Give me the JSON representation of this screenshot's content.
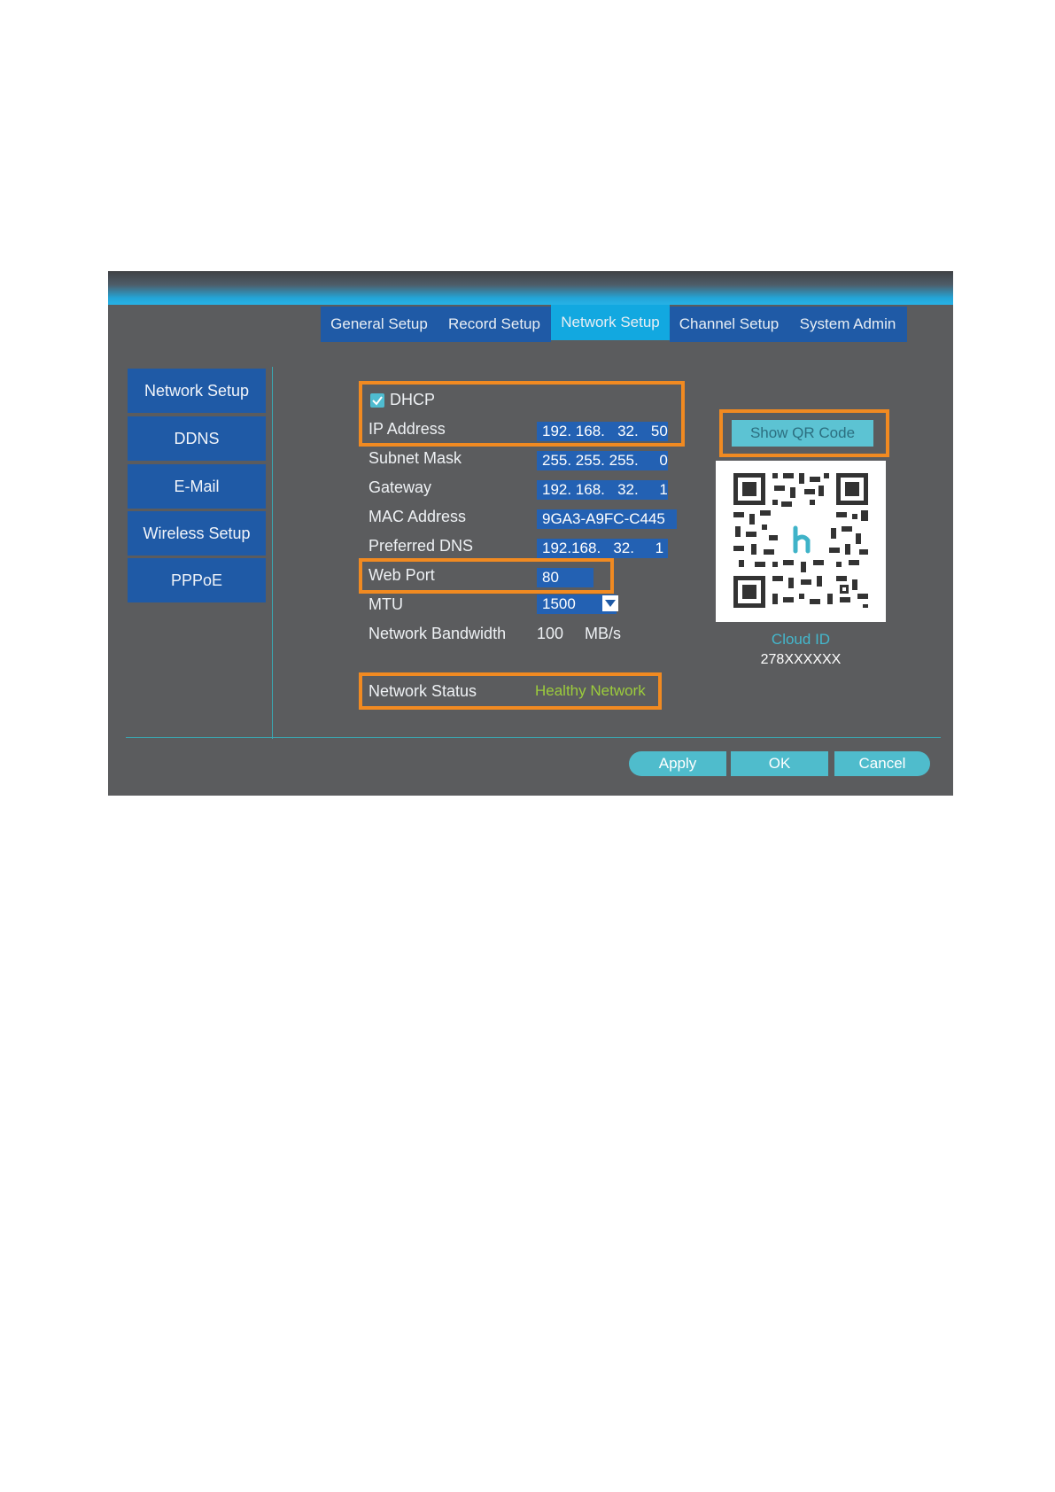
{
  "tabs": [
    {
      "label": "General Setup"
    },
    {
      "label": "Record Setup"
    },
    {
      "label": "Network Setup"
    },
    {
      "label": "Channel Setup"
    },
    {
      "label": "System Admin"
    }
  ],
  "active_tab": "Network Setup",
  "sidebar": {
    "items": [
      {
        "label": "Network Setup"
      },
      {
        "label": "DDNS"
      },
      {
        "label": "E-Mail"
      },
      {
        "label": "Wireless Setup"
      },
      {
        "label": "PPPoE"
      }
    ]
  },
  "form": {
    "dhcp_label": "DHCP",
    "dhcp_checked": true,
    "ip_label": "IP Address",
    "ip_value": "192. 168.   32.   50",
    "subnet_label": "Subnet Mask",
    "subnet_value": "255. 255. 255.     0",
    "gateway_label": "Gateway",
    "gateway_value": "192. 168.   32.     1",
    "mac_label": "MAC Address",
    "mac_value": "9GA3-A9FC-C445",
    "dns_label": "Preferred DNS",
    "dns_value": "192.168.   32.     1",
    "webport_label": "Web Port",
    "webport_value": "80",
    "mtu_label": "MTU",
    "mtu_value": "1500",
    "bandwidth_label": "Network Bandwidth",
    "bandwidth_value": "100",
    "bandwidth_unit": "MB/s",
    "status_label": "Network Status",
    "status_value": "Healthy Network"
  },
  "qr": {
    "button_label": "Show QR Code",
    "cloud_label": "Cloud ID",
    "cloud_id": "278XXXXXX"
  },
  "buttons": {
    "apply": "Apply",
    "ok": "OK",
    "cancel": "Cancel"
  },
  "colors": {
    "panel": "#5b5c5e",
    "tab": "#1f5aa6",
    "tab_active": "#12a8e0",
    "highlight": "#f18a21",
    "status_ok": "#9ccc3c",
    "button": "#4fbccc"
  }
}
